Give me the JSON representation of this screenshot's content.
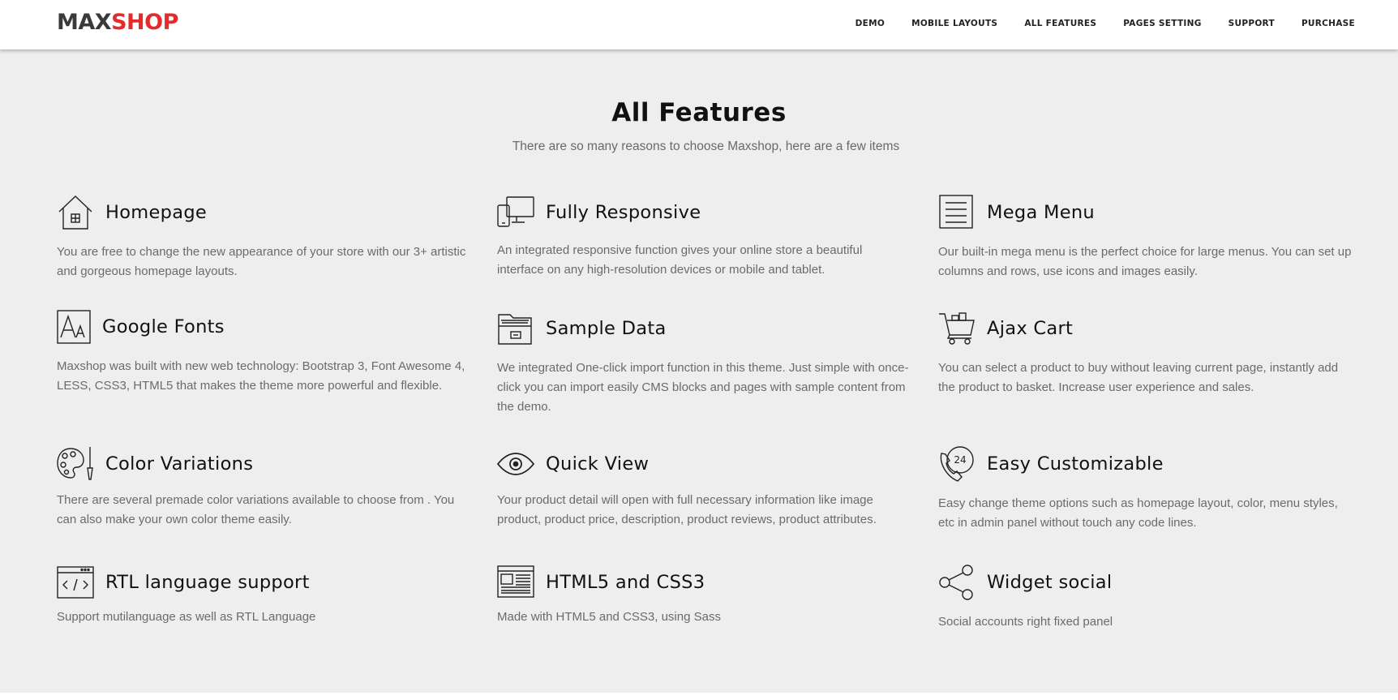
{
  "header": {
    "logo": {
      "max": "MAX",
      "shop": "SHOP"
    },
    "nav": [
      "DEMO",
      "MOBILE LAYOUTS",
      "ALL FEATURES",
      "PAGES SETTING",
      "SUPPORT",
      "PURCHASE"
    ]
  },
  "section": {
    "title": "All Features",
    "subtitle": "There are so many reasons to choose Maxshop, here are a few items"
  },
  "features": [
    {
      "icon": "house-icon",
      "title": "Homepage",
      "desc": "You are free to change the new appearance of your store with our 3+ artistic and gorgeous homepage layouts."
    },
    {
      "icon": "devices-icon",
      "title": "Fully Responsive",
      "desc": "An integrated responsive function gives your online store a beautiful interface on any high-resolution devices or mobile and tablet."
    },
    {
      "icon": "menu-list-icon",
      "title": "Mega Menu",
      "desc": "Our built-in mega menu is the perfect choice for large menus. You can set up columns and rows, use icons and images easily."
    },
    {
      "icon": "font-icon",
      "title": "Google Fonts",
      "desc": "Maxshop was built with new web technology: Bootstrap 3, Font Awesome 4, LESS, CSS3, HTML5 that makes the theme more powerful and flexible."
    },
    {
      "icon": "folder-icon",
      "title": "Sample Data",
      "desc": "We integrated One-click import function in this theme. Just simple with once-click you can import easily CMS blocks and pages with sample content from the demo."
    },
    {
      "icon": "cart-icon",
      "title": "Ajax Cart",
      "desc": "You can select a product to buy without leaving current page, instantly add the product to basket. Increase user experience and sales."
    },
    {
      "icon": "palette-icon",
      "title": "Color Variations",
      "desc": "There are several premade color variations available to choose from . You can also make your own color theme easily."
    },
    {
      "icon": "eye-icon",
      "title": "Quick View",
      "desc": "Your product detail will open with full necessary information like image product, product price, description, product reviews, product attributes."
    },
    {
      "icon": "support-24-icon",
      "title": "Easy Customizable",
      "desc": "Easy change theme options such as homepage layout, color, menu styles, etc in admin panel without touch any code lines."
    },
    {
      "icon": "code-window-icon",
      "title": "RTL language support",
      "desc": "Support mutilanguage as well as RTL Language"
    },
    {
      "icon": "html-layout-icon",
      "title": "HTML5 and CSS3",
      "desc": "Made with HTML5 and CSS3, using Sass"
    },
    {
      "icon": "share-icon",
      "title": "Widget social",
      "desc": "Social accounts right fixed panel"
    }
  ]
}
